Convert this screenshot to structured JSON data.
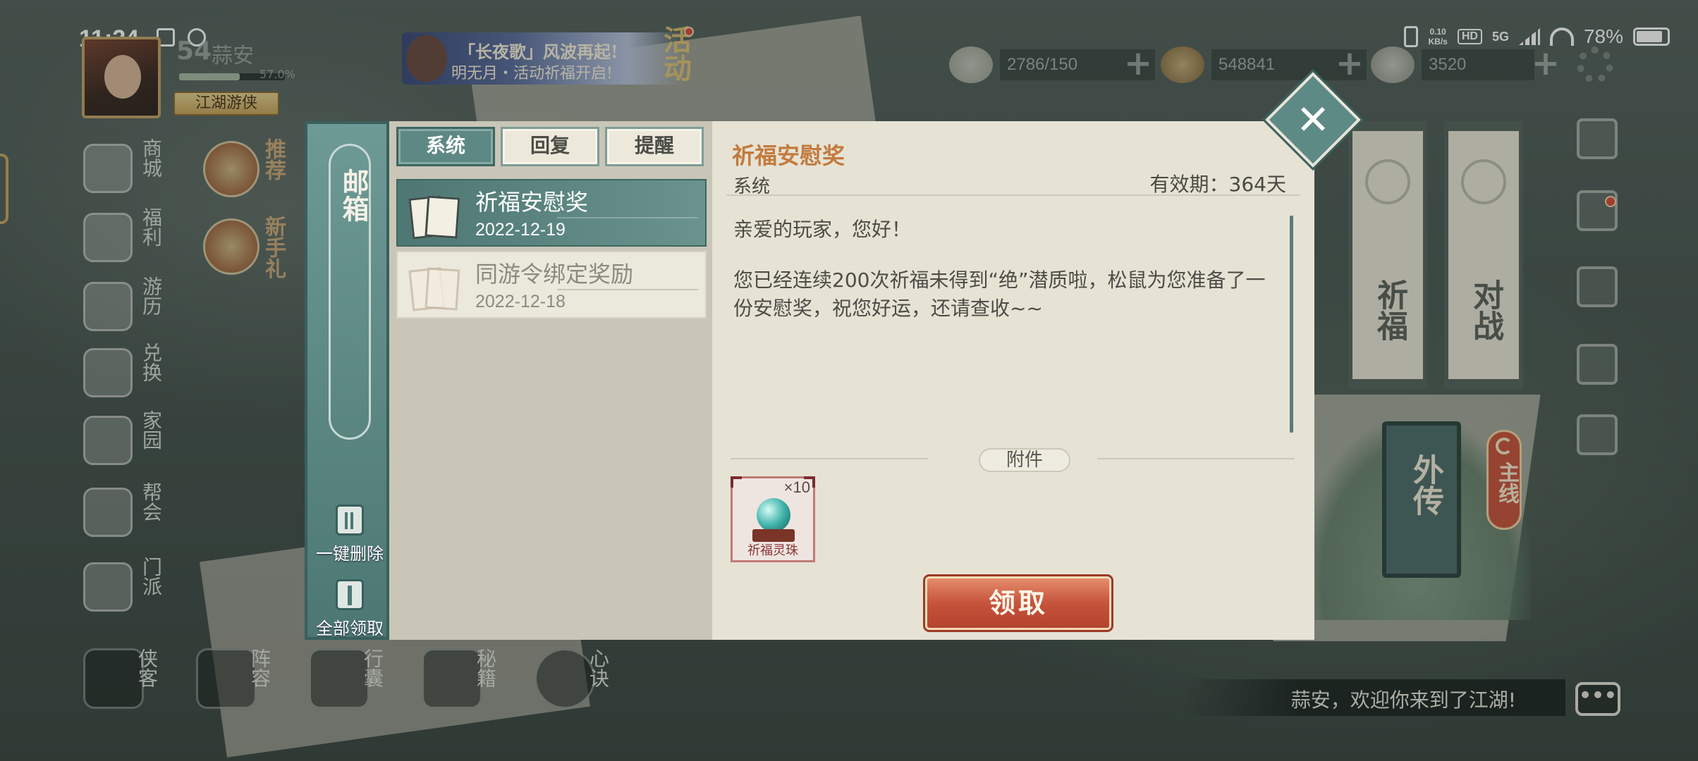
{
  "status_bar": {
    "time": "11:24",
    "net_speed_top": "0.10",
    "net_speed_unit": "KB/s",
    "hd": "HD",
    "signal": "5G",
    "battery": "78%"
  },
  "player": {
    "level": "54",
    "name": "蒜安",
    "exp_percent": "57.0%",
    "title": "江湖游侠"
  },
  "event_banner": {
    "line1": "「长夜歌」风波再起!",
    "line2": "明无月・活动祈福开启!",
    "tag": "活动"
  },
  "resources": [
    {
      "icon": "rice-cake-icon",
      "value": "2786/150"
    },
    {
      "icon": "coin-pile-icon",
      "value": "548841"
    },
    {
      "icon": "ingot-icon",
      "value": "3520"
    }
  ],
  "left_nav": [
    {
      "label": "商城"
    },
    {
      "label": "福利"
    },
    {
      "label": "游历"
    },
    {
      "label": "兑换"
    },
    {
      "label": "家园"
    },
    {
      "label": "帮会"
    },
    {
      "label": "门派"
    }
  ],
  "recommend": [
    {
      "label": "推荐"
    },
    {
      "label": "新手礼"
    }
  ],
  "scene_banners": [
    {
      "label": "祈福"
    },
    {
      "label": "对战"
    }
  ],
  "waizhuan": "外传",
  "mainline": "主线",
  "bottom_nav": [
    {
      "label": "侠客"
    },
    {
      "label": "阵容"
    },
    {
      "label": "行囊"
    },
    {
      "label": "秘籍"
    },
    {
      "label": "心诀"
    }
  ],
  "chat": {
    "message": "蒜安，欢迎你来到了江湖!",
    "icon_text": "•••"
  },
  "mailbox": {
    "title": "邮箱",
    "delete_all": "一键删除",
    "claim_all": "全部领取",
    "tabs": [
      {
        "label": "系统",
        "active": true
      },
      {
        "label": "回复",
        "active": false
      },
      {
        "label": "提醒",
        "active": false
      }
    ],
    "mails": [
      {
        "title": "祈福安慰奖",
        "date": "2022-12-19",
        "state": "active"
      },
      {
        "title": "同游令绑定奖励",
        "date": "2022-12-18",
        "state": "read"
      }
    ],
    "detail": {
      "title": "祈福安慰奖",
      "sender": "系统",
      "expiry": "有效期：364天",
      "greeting": "亲爱的玩家，您好！",
      "body": "您已经连续200次祈福未得到“绝”潜质啦，松鼠为您准备了一份安慰奖，祝您好运，还请查收~~",
      "attachments_label": "附件",
      "attachments": [
        {
          "name": "祈福灵珠",
          "quantity": "×10"
        }
      ],
      "claim_button": "领取"
    },
    "close_label": "✕"
  }
}
